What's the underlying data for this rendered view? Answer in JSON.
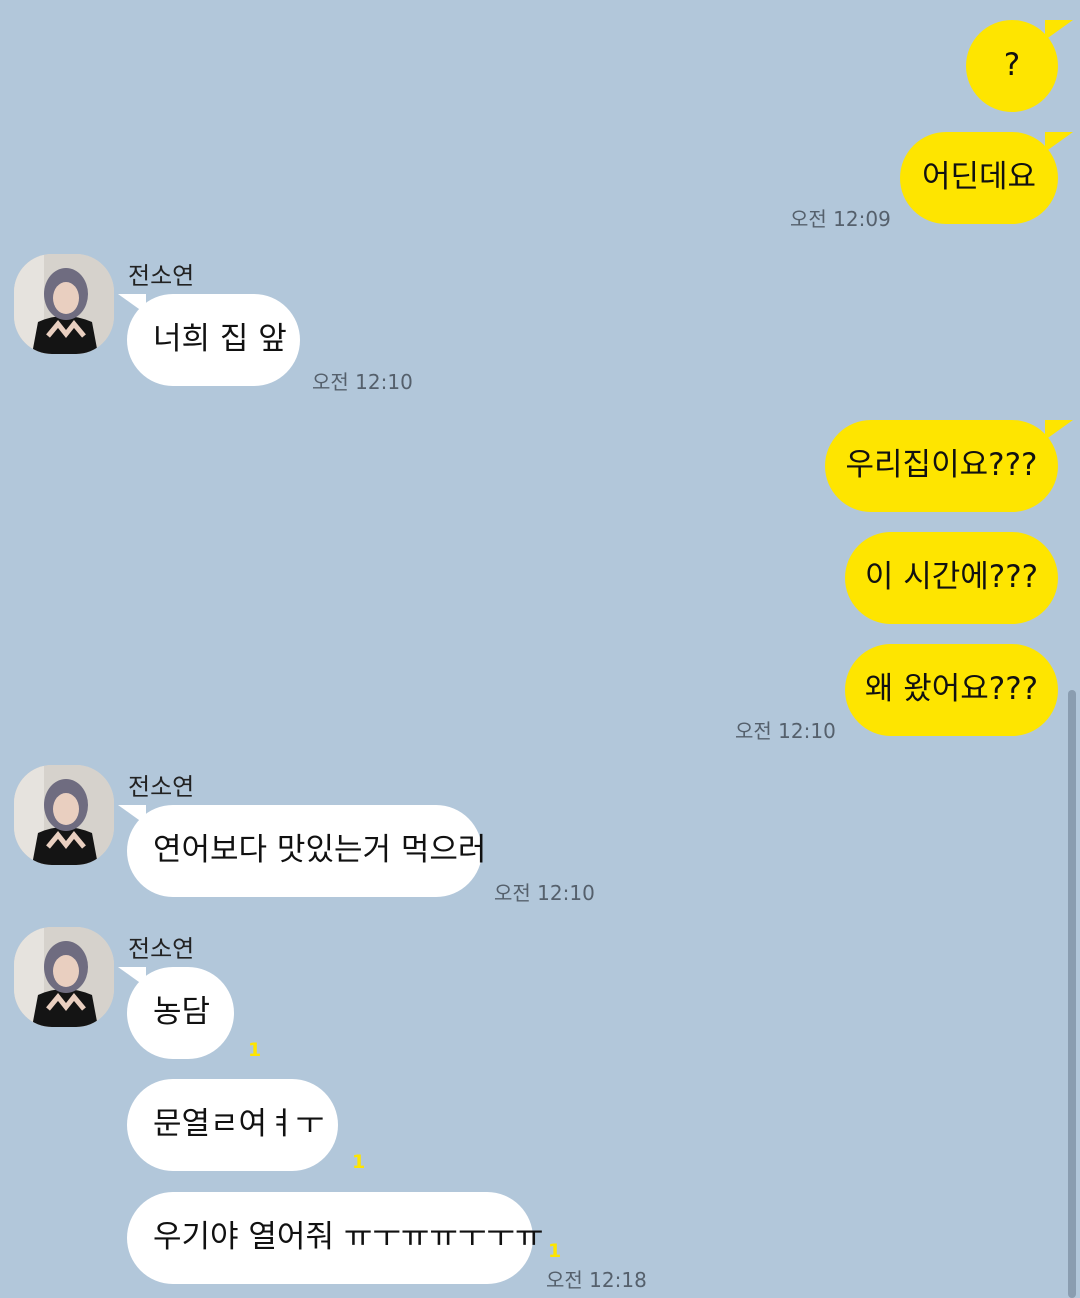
{
  "chat": {
    "contact_name": "전소연",
    "messages": [
      {
        "side": "me",
        "text": "?"
      },
      {
        "side": "me",
        "text": "어딘데요",
        "time": "오전 12:09"
      },
      {
        "side": "other",
        "sender": "전소연",
        "text": "너희 집 앞",
        "time": "오전 12:10"
      },
      {
        "side": "me",
        "text": "우리집이요???"
      },
      {
        "side": "me",
        "text": "이 시간에???"
      },
      {
        "side": "me",
        "text": "왜 왔어요???",
        "time": "오전 12:10"
      },
      {
        "side": "other",
        "sender": "전소연",
        "text": "연어보다 맛있는거 먹으러",
        "time": "오전 12:10"
      },
      {
        "side": "other",
        "sender": "전소연",
        "text": "농담",
        "unread": "1"
      },
      {
        "side": "other",
        "text": "문열ㄹ여ㅕㅜ",
        "unread": "1"
      },
      {
        "side": "other",
        "text": "우기야 열어줘 ㅠㅜㅠㅠㅜㅜㅠ",
        "unread": "1",
        "time": "오전 12:18"
      }
    ]
  },
  "colors": {
    "background": "#b2c7da",
    "my_bubble": "#fee500",
    "other_bubble": "#ffffff",
    "unread_count": "#fee500"
  }
}
